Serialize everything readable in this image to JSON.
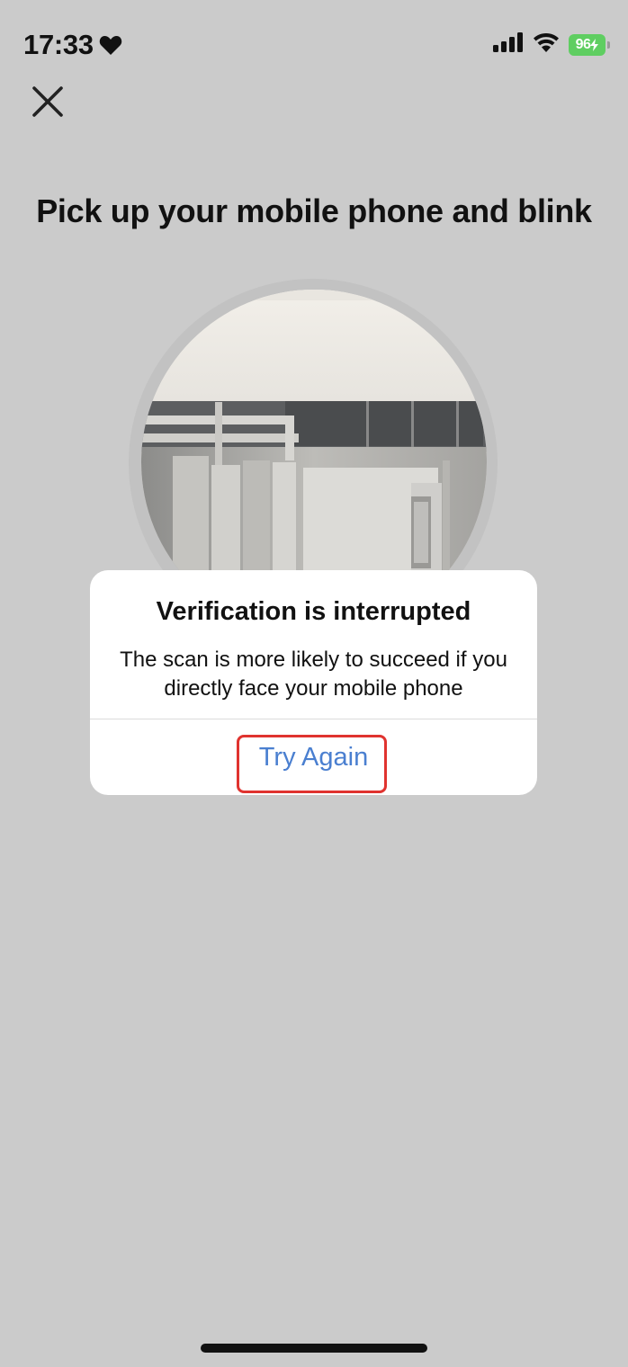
{
  "status_bar": {
    "time": "17:33",
    "battery_level": "96",
    "icons": [
      "heart-icon",
      "signal-icon",
      "wifi-icon",
      "battery-icon"
    ],
    "battery_color": "#5fce61"
  },
  "header": {
    "close_icon": "close-icon"
  },
  "main": {
    "title": "Pick up your mobile phone and blink"
  },
  "dialog": {
    "title": "Verification is interrupted",
    "message": "The scan is more likely to succeed if you directly face your mobile phone",
    "action_label": "Try Again",
    "action_color": "#4a7fd0",
    "highlight_color": "#e0332f"
  }
}
